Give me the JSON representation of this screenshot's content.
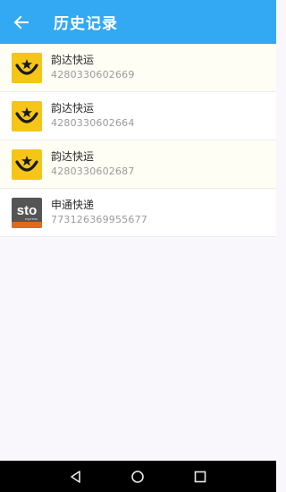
{
  "header": {
    "title": "历史记录",
    "back_icon": "arrow-left-icon"
  },
  "colors": {
    "app_bar": "#33a9f3",
    "yunda_logo_bg": "#f5c518",
    "sto_logo_bg": "#555555",
    "sto_accent": "#e06a1b"
  },
  "records": [
    {
      "company": "韵达快运",
      "tracking": "4280330602669",
      "logo": "yunda-logo"
    },
    {
      "company": "韵达快运",
      "tracking": "4280330602664",
      "logo": "yunda-logo"
    },
    {
      "company": "韵达快运",
      "tracking": "4280330602687",
      "logo": "yunda-logo"
    },
    {
      "company": "申通快递",
      "tracking": "773126369955677",
      "logo": "sto-logo",
      "logo_text": "sto",
      "logo_subtext": "express"
    }
  ],
  "nav": {
    "back": "triangle-back-icon",
    "home": "circle-home-icon",
    "recents": "square-recents-icon"
  }
}
